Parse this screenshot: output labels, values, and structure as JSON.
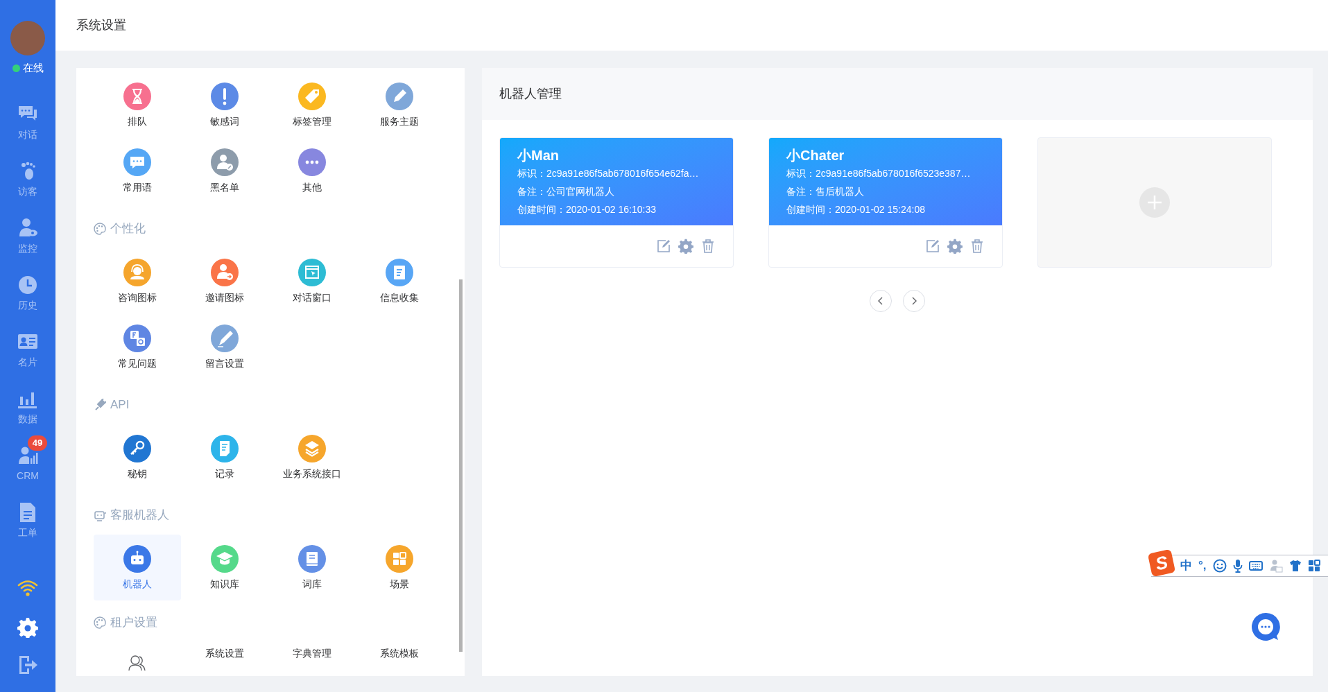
{
  "sidebar": {
    "status": {
      "label": "在线",
      "online": true
    },
    "nav": [
      {
        "label": "对话",
        "kind": "chat"
      },
      {
        "label": "访客",
        "kind": "footprint"
      },
      {
        "label": "监控",
        "kind": "monitor"
      },
      {
        "label": "历史",
        "kind": "clock"
      },
      {
        "label": "名片",
        "kind": "card"
      },
      {
        "label": "数据",
        "kind": "chart"
      },
      {
        "label": "CRM",
        "kind": "crm",
        "badge": "49"
      },
      {
        "label": "工单",
        "kind": "doc"
      }
    ]
  },
  "header": {
    "title": "系统设置"
  },
  "settings": {
    "sections": [
      {
        "items": [
          {
            "label": "排队",
            "kind": "hourglass",
            "color": "#f7708f",
            "selected": false
          },
          {
            "label": "敏感词",
            "kind": "exclaim",
            "color": "#5c8ae6",
            "selected": false
          },
          {
            "label": "标签管理",
            "kind": "tag",
            "color": "#fbb820",
            "selected": false
          },
          {
            "label": "服务主题",
            "kind": "pencil",
            "color": "#7fa7d9",
            "selected": false
          },
          {
            "label": "常用语",
            "kind": "bubble",
            "color": "#55a7f5",
            "selected": false
          },
          {
            "label": "黑名单",
            "kind": "person-block",
            "color": "#8d9cab",
            "selected": false
          },
          {
            "label": "其他",
            "kind": "dots",
            "color": "#8787df",
            "selected": false
          }
        ]
      },
      {
        "title": "个性化",
        "kind": "palette",
        "items": [
          {
            "label": "咨询图标",
            "kind": "headset",
            "color": "#f5a52c",
            "selected": false
          },
          {
            "label": "邀请图标",
            "kind": "person-arrow",
            "color": "#fa7448",
            "selected": false
          },
          {
            "label": "对话窗口",
            "kind": "window",
            "color": "#2dbcd4",
            "selected": false
          },
          {
            "label": "信息收集",
            "kind": "form",
            "color": "#58a6f5",
            "selected": false
          },
          {
            "label": "常见问题",
            "kind": "faq",
            "color": "#5f86e3",
            "selected": false
          },
          {
            "label": "留言设置",
            "kind": "write",
            "color": "#7fa7d9",
            "selected": false
          }
        ]
      },
      {
        "title": "API",
        "kind": "plug",
        "items": [
          {
            "label": "秘钥",
            "kind": "key",
            "color": "#2176d2",
            "selected": false
          },
          {
            "label": "记录",
            "kind": "record",
            "color": "#2db4ea",
            "selected": false
          },
          {
            "label": "业务系统接口",
            "kind": "layers",
            "color": "#f6a62c",
            "selected": false
          }
        ]
      },
      {
        "title": "客服机器人",
        "kind": "robot-outline",
        "items": [
          {
            "label": "机器人",
            "kind": "robot",
            "color": "#3b78e7",
            "selected": true
          },
          {
            "label": "知识库",
            "kind": "cap",
            "color": "#55d98a",
            "selected": false
          },
          {
            "label": "词库",
            "kind": "book",
            "color": "#6490e6",
            "selected": false
          },
          {
            "label": "场景",
            "kind": "grid",
            "color": "#f6a62c",
            "selected": false
          }
        ]
      },
      {
        "title": "租户设置",
        "kind": "palette",
        "items": [
          {
            "kind": "people-outline",
            "selected": false
          },
          {
            "label": "系统设置",
            "selected": false
          },
          {
            "label": "字典管理",
            "selected": false
          },
          {
            "label": "系统模板",
            "selected": false
          }
        ]
      }
    ]
  },
  "robots": {
    "title": "机器人管理",
    "cards": [
      {
        "name": "小Man",
        "id": "标识：2c9a91e86f5ab678016f654e62fa…",
        "note": "备注：公司官网机器人",
        "created": "创建时间：2020-01-02 16:10:33"
      },
      {
        "name": "小Chater",
        "id": "标识：2c9a91e86f5ab678016f6523e387…",
        "note": "备注：售后机器人",
        "created": "创建时间：2020-01-02 15:24:08"
      }
    ]
  },
  "ime": {
    "logo": "S",
    "mode": "中",
    "punct": "°,"
  }
}
